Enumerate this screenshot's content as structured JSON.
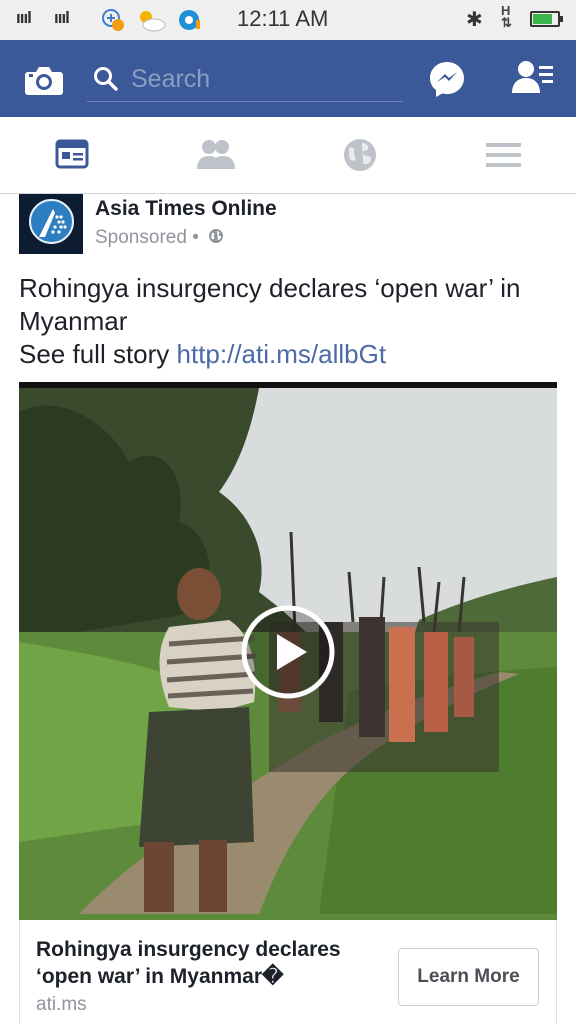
{
  "status_bar": {
    "signal_1": "ıııl",
    "signal_2": "ıııl",
    "time": "12:11 AM",
    "network": "H",
    "battery_level": 0.8,
    "icons": [
      "signal-icon",
      "signal-icon",
      "app-notification-icon",
      "weather-icon",
      "notification-icon",
      "bluetooth-icon",
      "network-icon",
      "battery-icon"
    ]
  },
  "header": {
    "search_placeholder": "Search",
    "icons": [
      "camera-icon",
      "search-icon",
      "messenger-icon",
      "friend-requests-icon"
    ]
  },
  "nav": {
    "tabs": [
      "news-feed-icon",
      "friends-icon",
      "globe-icon",
      "menu-icon"
    ],
    "active_color": "#3b5998",
    "inactive_color": "#bec2c9"
  },
  "post": {
    "page_name": "Asia Times Online",
    "sponsored": "Sponsored",
    "separator": "•",
    "text_line": "Rohingya insurgency declares  ‘open war’  in Myanmar",
    "see_full": "See full story ",
    "link": "http://ati.ms/allbGt",
    "video": {
      "icon": "play-icon"
    },
    "card": {
      "title": "Rohingya insurgency declares ‘open war’ in Myanmar�",
      "domain": "ati.ms",
      "cta": "Learn More"
    }
  },
  "colors": {
    "brand": "#3b5998",
    "link": "#4b6aa6",
    "muted": "#90949c"
  }
}
